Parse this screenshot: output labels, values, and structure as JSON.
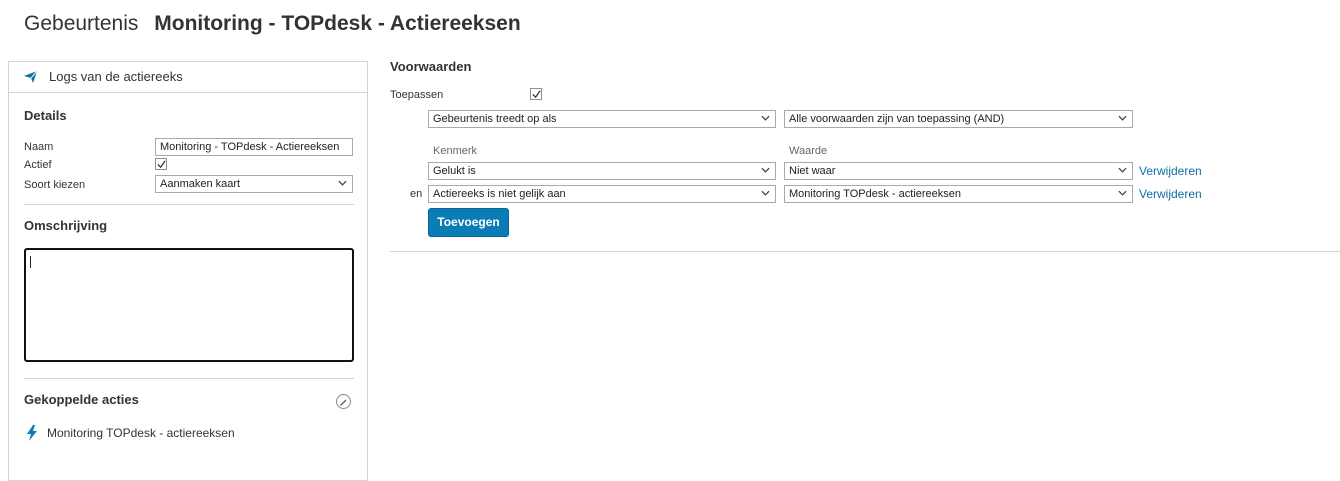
{
  "header": {
    "prefix": "Gebeurtenis",
    "name": "Monitoring - TOPdesk - Actiereeksen"
  },
  "left_panel": {
    "logs_link": "Logs van de actiereeks",
    "details_title": "Details",
    "naam_label": "Naam",
    "naam_value": "Monitoring - TOPdesk - Actiereeksen",
    "actief_label": "Actief",
    "actief_checked": true,
    "soort_label": "Soort kiezen",
    "soort_value": "Aanmaken kaart",
    "omschrijving_title": "Omschrijving",
    "omschrijving_value": "",
    "gekoppelde_title": "Gekoppelde acties",
    "linked_action": "Monitoring TOPdesk - actiereeksen",
    "icons": {
      "logs": "arrow-icon",
      "edit": "pencil-icon",
      "action": "lightning-icon"
    }
  },
  "conditions": {
    "title": "Voorwaarden",
    "toepassen_label": "Toepassen",
    "toepassen_checked": true,
    "trigger_select": "Gebeurtenis treedt op als",
    "logic_select": "Alle voorwaarden zijn van toepassing (AND)",
    "col_kenmerk": "Kenmerk",
    "col_waarde": "Waarde",
    "rows": [
      {
        "prefix": "",
        "kenmerk": "Gelukt is",
        "waarde": "Niet waar",
        "remove": "Verwijderen"
      },
      {
        "prefix": "en",
        "kenmerk": "Actiereeks is niet gelijk aan",
        "waarde": "Monitoring TOPdesk - actiereeksen",
        "remove": "Verwijderen"
      }
    ],
    "add_button": "Toevoegen"
  },
  "colors": {
    "accent": "#0b7db5",
    "link": "#0f6ea4",
    "border": "#d4d4d4"
  }
}
